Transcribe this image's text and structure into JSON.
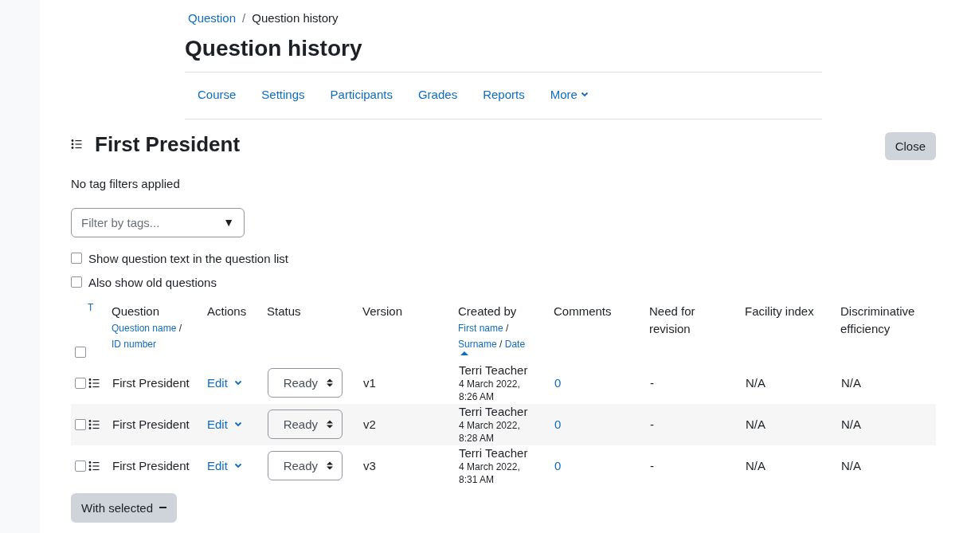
{
  "breadcrumb_separator": "/",
  "breadcrumb": [
    {
      "label": "Question",
      "kind": "link"
    },
    {
      "label": "Question history",
      "kind": "current"
    }
  ],
  "page_title": "Question history",
  "nav_tabs": [
    {
      "label": "Course",
      "kind": "link"
    },
    {
      "label": "Settings",
      "kind": "link"
    },
    {
      "label": "Participants",
      "kind": "link"
    },
    {
      "label": "Grades",
      "kind": "link"
    },
    {
      "label": "Reports",
      "kind": "link"
    },
    {
      "label": "More",
      "kind": "menu"
    }
  ],
  "heading": "First President",
  "close_button": "Close",
  "tag_status": "No tag filters applied",
  "tag_filter": {
    "placeholder": "Filter by tags...",
    "arrow": "▼"
  },
  "options": [
    {
      "label": "Show question text in the question list",
      "checked": false
    },
    {
      "label": "Also show old questions",
      "checked": false
    }
  ],
  "table": {
    "type_sort": "T",
    "sort_separator": "/",
    "select_all_checked": false,
    "columns": [
      {
        "label": "Question",
        "sort_links": [
          {
            "label": "Question name",
            "sorted": false
          },
          {
            "label": "ID number",
            "sorted": false
          }
        ]
      },
      {
        "label": "Actions"
      },
      {
        "label": "Status"
      },
      {
        "label": "Version"
      },
      {
        "label": "Created by",
        "sort_links": [
          {
            "label": "First name",
            "sorted": false
          },
          {
            "label": "Surname",
            "sorted": false
          },
          {
            "label": "Date",
            "sorted": true
          }
        ]
      },
      {
        "label": "Comments"
      },
      {
        "label": "Need for revision"
      },
      {
        "label": "Facility index"
      },
      {
        "label": "Discriminative efficiency"
      }
    ],
    "rows": [
      {
        "checked": false,
        "question": "First President",
        "action": "Edit",
        "status": "Ready",
        "version": "v1",
        "created_by": "Terri Teacher",
        "created_date": "4 March 2022, 8:26 AM",
        "comments": "0",
        "need_for_revision": "-",
        "facility_index": "N/A",
        "discriminative_efficiency": "N/A"
      },
      {
        "checked": false,
        "question": "First President",
        "action": "Edit",
        "status": "Ready",
        "version": "v2",
        "created_by": "Terri Teacher",
        "created_date": "4 March 2022, 8:28 AM",
        "comments": "0",
        "need_for_revision": "-",
        "facility_index": "N/A",
        "discriminative_efficiency": "N/A"
      },
      {
        "checked": false,
        "question": "First President",
        "action": "Edit",
        "status": "Ready",
        "version": "v3",
        "created_by": "Terri Teacher",
        "created_date": "4 March 2022, 8:31 AM",
        "comments": "0",
        "need_for_revision": "-",
        "facility_index": "N/A",
        "discriminative_efficiency": "N/A"
      }
    ]
  },
  "with_selected_button": "With selected"
}
